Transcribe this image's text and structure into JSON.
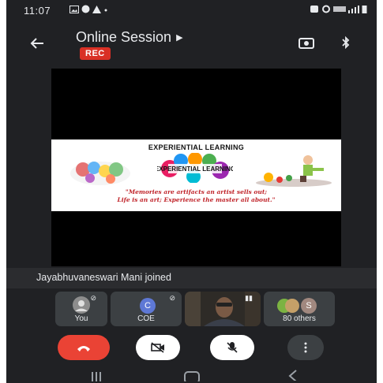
{
  "status_bar": {
    "time": "11:07",
    "left_icons": [
      "image-icon",
      "whatsapp-icon",
      "alert-icon",
      "dot-icon"
    ],
    "right_icons": [
      "alarm-icon",
      "bluetooth-icon",
      "volte-icon",
      "4g-icon",
      "signal-icon",
      "battery-icon"
    ]
  },
  "header": {
    "title": "Online Session",
    "rec_label": "REC"
  },
  "slide": {
    "title": "EXPERIENTIAL LEARNING",
    "logo_text": "EXPERIENTIAL LEARNING",
    "quote_line1": "\"Memories are artifacts an artist sells out;",
    "quote_line2": "Life is an art; Experience the master all about.\""
  },
  "notification": "Jayabhuvaneswari Mani joined",
  "participants": [
    {
      "label": "You",
      "avatar": ""
    },
    {
      "label": "COE",
      "avatar": "C"
    },
    {
      "label": "",
      "avatar": ""
    },
    {
      "label": "80 others",
      "avatar": "S"
    }
  ],
  "colors": {
    "background": "#202124",
    "tile": "#3c4043",
    "rec": "#d93025",
    "end_call": "#ea4335",
    "control_light": "#ffffff"
  }
}
